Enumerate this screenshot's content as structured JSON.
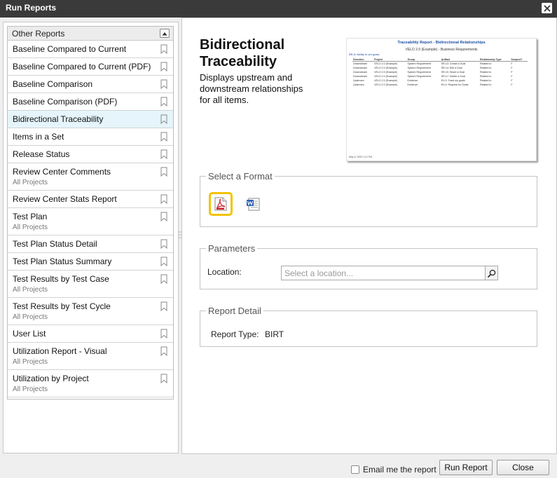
{
  "window": {
    "title": "Run Reports"
  },
  "report_list": {
    "header": "Other Reports",
    "items": [
      {
        "name": "Baseline Compared to Current",
        "sub": ""
      },
      {
        "name": "Baseline Compared to Current (PDF)",
        "sub": ""
      },
      {
        "name": "Baseline Comparison",
        "sub": ""
      },
      {
        "name": "Baseline Comparison (PDF)",
        "sub": ""
      },
      {
        "name": "Bidirectional Traceability",
        "sub": "",
        "selected": true
      },
      {
        "name": "Items in a Set",
        "sub": ""
      },
      {
        "name": "Release Status",
        "sub": ""
      },
      {
        "name": "Review Center Comments",
        "sub": "All Projects"
      },
      {
        "name": "Review Center Stats Report",
        "sub": ""
      },
      {
        "name": "Test Plan",
        "sub": "All Projects"
      },
      {
        "name": "Test Plan Status Detail",
        "sub": ""
      },
      {
        "name": "Test Plan Status Summary",
        "sub": ""
      },
      {
        "name": "Test Results by Test Case",
        "sub": "All Projects"
      },
      {
        "name": "Test Results by Test Cycle",
        "sub": "All Projects"
      },
      {
        "name": "User List",
        "sub": ""
      },
      {
        "name": "Utilization Report - Visual",
        "sub": "All Projects"
      },
      {
        "name": "Utilization by Project",
        "sub": "All Projects"
      }
    ]
  },
  "detail": {
    "title": "Bidirectional Traceability",
    "description": "Displays upstream and downstream relationships for all items.",
    "preview": {
      "title": "Traceability Report - Bidirectional Relationships",
      "subtitle": "VELO 2.0 (Example) - Business Requirements",
      "link": "BR-5: Ability to set goals",
      "columns": [
        "Direction",
        "Project",
        "Group",
        "Artifact",
        "Relationship Type",
        "Suspect?"
      ],
      "rows": [
        [
          "Downstream",
          "VELO 2.0 (Example)",
          "System Requirement",
          "SR-13: Create a Goal",
          "Related to",
          "F"
        ],
        [
          "Downstream",
          "VELO 2.0 (Example)",
          "System Requirement",
          "SR-14: Edit a Goal",
          "Related to",
          "F"
        ],
        [
          "Downstream",
          "VELO 2.0 (Example)",
          "System Requirement",
          "SR-15: Share a Goal",
          "Related to",
          "F"
        ],
        [
          "Downstream",
          "VELO 2.0 (Example)",
          "System Requirement",
          "SR-17: Delete a Goal",
          "Related to",
          "F"
        ],
        [
          "Upstream",
          "VELO 2.0 (Example)",
          "Evidence",
          "EV-3: Track my goals",
          "Related to",
          "F"
        ],
        [
          "Upstream",
          "VELO 2.0 (Example)",
          "Evidence",
          "EV-4: Request for Goals",
          "Related to",
          "F"
        ]
      ],
      "footer": "May 6, 2009 1:21 PM"
    }
  },
  "format": {
    "legend": "Select a Format",
    "selected": "pdf"
  },
  "parameters": {
    "legend": "Parameters",
    "location_label": "Location:",
    "location_placeholder": "Select a location..."
  },
  "report_detail": {
    "legend": "Report Detail",
    "type_label": "Report Type:",
    "type_value": "BIRT"
  },
  "footer": {
    "email_label": "Email me the report",
    "email_checked": false,
    "run_label": "Run Report",
    "close_label": "Close"
  }
}
